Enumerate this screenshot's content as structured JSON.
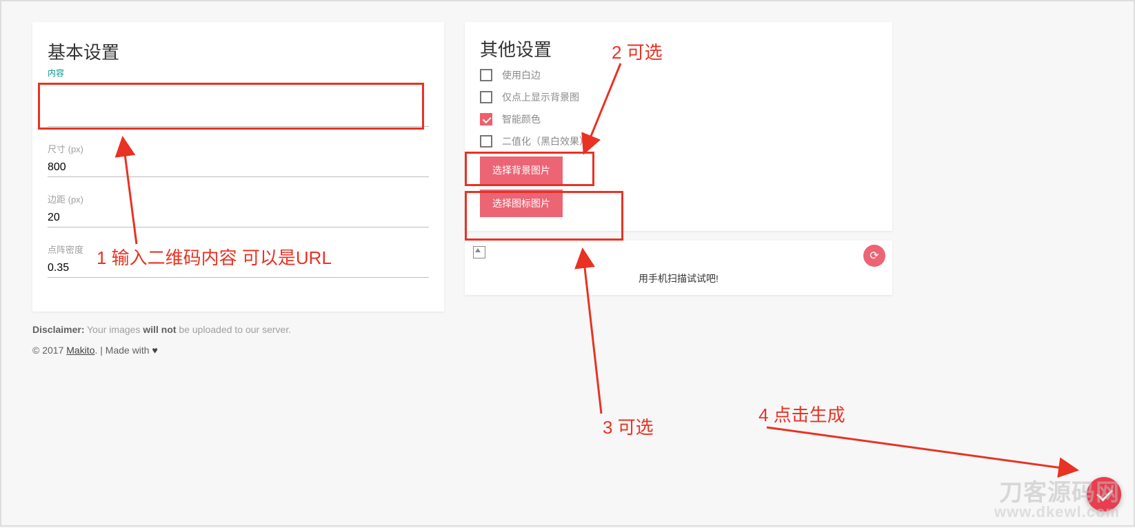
{
  "basic": {
    "title": "基本设置",
    "content_label": "内容",
    "content_value": "",
    "size_label": "尺寸 (px)",
    "size_value": "800",
    "margin_label": "边距 (px)",
    "margin_value": "20",
    "density_label": "点阵密度",
    "density_value": "0.35"
  },
  "other": {
    "title": "其他设置",
    "options": [
      {
        "label": "使用白边",
        "checked": false
      },
      {
        "label": "仅点上显示背景图",
        "checked": false
      },
      {
        "label": "智能颜色",
        "checked": true
      },
      {
        "label": "二值化（黑白效果）",
        "checked": false
      }
    ],
    "choose_bg_btn": "选择背景图片",
    "choose_icon_btn": "选择图标图片"
  },
  "preview": {
    "caption": "用手机扫描试试吧!"
  },
  "footer": {
    "disclaimer_bold": "Disclaimer:",
    "disclaimer_mid": " Your images ",
    "disclaimer_bold2": "will not",
    "disclaimer_end": " be uploaded to our server.",
    "copyright_prefix": "© 2017 ",
    "author": "Makito",
    "copyright_suffix": ". | Made with "
  },
  "annotations": {
    "a1": "1 输入二维码内容 可以是URL",
    "a2": "2 可选",
    "a3": "3 可选",
    "a4": "4 点击生成"
  },
  "watermark": {
    "line1": "刀客源码网",
    "line2": "www.dkewl.com"
  }
}
